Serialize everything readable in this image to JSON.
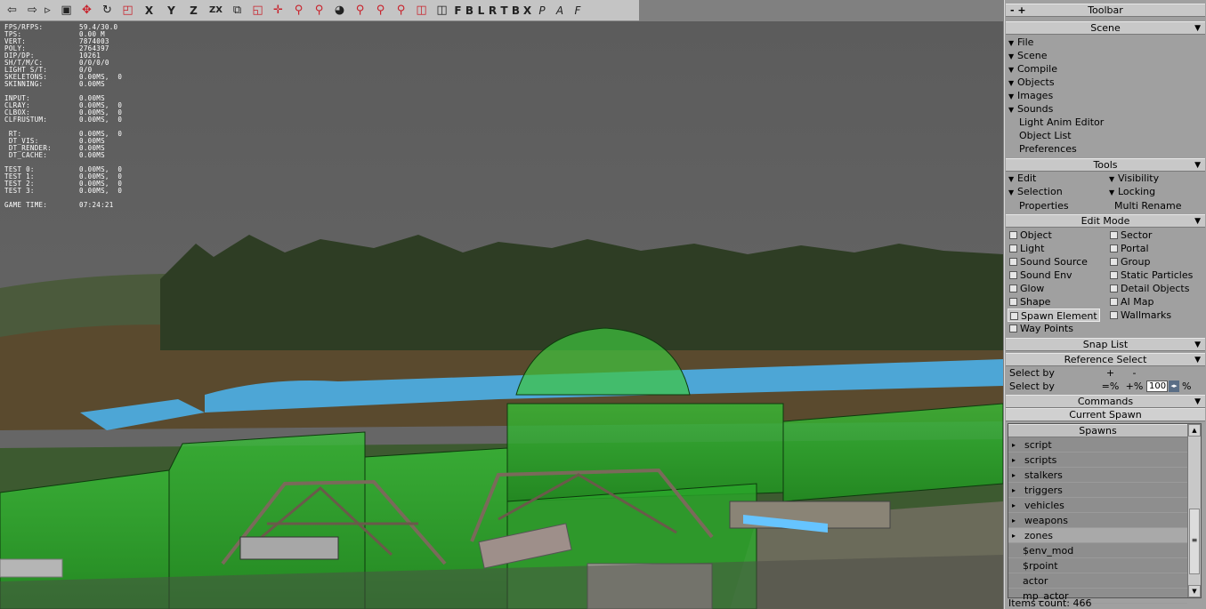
{
  "toolbar": {
    "axis_labels": [
      "X",
      "Y",
      "Z",
      "ZX"
    ],
    "view_labels": [
      "F",
      "B",
      "L",
      "R",
      "T",
      "B",
      "X"
    ],
    "italic_labels": [
      "P",
      "A",
      "F"
    ]
  },
  "stats": [
    {
      "k": "FPS/RFPS:",
      "v": "59.4/30.0"
    },
    {
      "k": "TPS:",
      "v": "0.00 M"
    },
    {
      "k": "VERT:",
      "v": "7874003"
    },
    {
      "k": "POLY:",
      "v": "2764397"
    },
    {
      "k": "DIP/DP:",
      "v": "10261"
    },
    {
      "k": "SH/T/M/C:",
      "v": "0/0/0/0"
    },
    {
      "k": "LIGHT S/T:",
      "v": "0/0"
    },
    {
      "k": "SKELETONS:",
      "v": "0.00MS,  0"
    },
    {
      "k": "SKINNING:",
      "v": "0.00MS"
    },
    {
      "k": "",
      "v": ""
    },
    {
      "k": "INPUT:",
      "v": "0.00MS"
    },
    {
      "k": "CLRAY:",
      "v": "0.00MS,  0"
    },
    {
      "k": "CLBOX:",
      "v": "0.00MS,  0"
    },
    {
      "k": "CLFRUSTUM:",
      "v": "0.00MS,  0"
    },
    {
      "k": "",
      "v": ""
    },
    {
      "k": " RT:",
      "v": "0.00MS,  0"
    },
    {
      "k": " DT_VIS:",
      "v": "0.00MS"
    },
    {
      "k": " DT_RENDER:",
      "v": "0.00MS"
    },
    {
      "k": " DT_CACHE:",
      "v": "0.00MS"
    },
    {
      "k": "",
      "v": ""
    },
    {
      "k": "TEST 0:",
      "v": "0.00MS,  0"
    },
    {
      "k": "TEST 1:",
      "v": "0.00MS,  0"
    },
    {
      "k": "TEST 2:",
      "v": "0.00MS,  0"
    },
    {
      "k": "TEST 3:",
      "v": "0.00MS,  0"
    },
    {
      "k": "",
      "v": ""
    },
    {
      "k": "GAME TIME:",
      "v": "07:24:21"
    }
  ],
  "panel": {
    "toolbar_title": "Toolbar",
    "toolbar_pm": "- +",
    "scene_title": "Scene",
    "scene_menus": [
      "File",
      "Scene",
      "Compile",
      "Objects",
      "Images",
      "Sounds"
    ],
    "scene_links": [
      "Light Anim Editor",
      "Object List",
      "Preferences"
    ],
    "tools_title": "Tools",
    "tools": {
      "edit": "Edit",
      "visibility": "Visibility",
      "selection": "Selection",
      "locking": "Locking",
      "properties": "Properties",
      "multi_rename": "Multi Rename"
    },
    "edit_mode_title": "Edit Mode",
    "edit_left": [
      "Object",
      "Light",
      "Sound Source",
      "Sound Env",
      "Glow",
      "Shape",
      "Spawn Element",
      "Way Points"
    ],
    "edit_right": [
      "Sector",
      "Portal",
      "Group",
      "Static Particles",
      "Detail Objects",
      "AI Map",
      "Wallmarks"
    ],
    "snap_title": "Snap List",
    "ref_title": "Reference Select",
    "select_by": "Select by",
    "plus": "+",
    "minus": "-",
    "eq_pct": "=%",
    "plus_pct": "+%",
    "pct_value": "100",
    "pct": "%",
    "commands_title": "Commands",
    "current_spawn": "Current Spawn",
    "spawns_title": "Spawns",
    "spawns": [
      "script",
      "scripts",
      "stalkers",
      "triggers",
      "vehicles",
      "weapons",
      "zones"
    ],
    "spawn_items": [
      "$env_mod",
      "$rpoint",
      "actor",
      "mp_actor"
    ],
    "items_count": "Items count: 466"
  },
  "colors": {
    "ui_gray": "#c8c8c8",
    "panel": "#a0a0a0",
    "zone_green": "#2ecc2e"
  }
}
